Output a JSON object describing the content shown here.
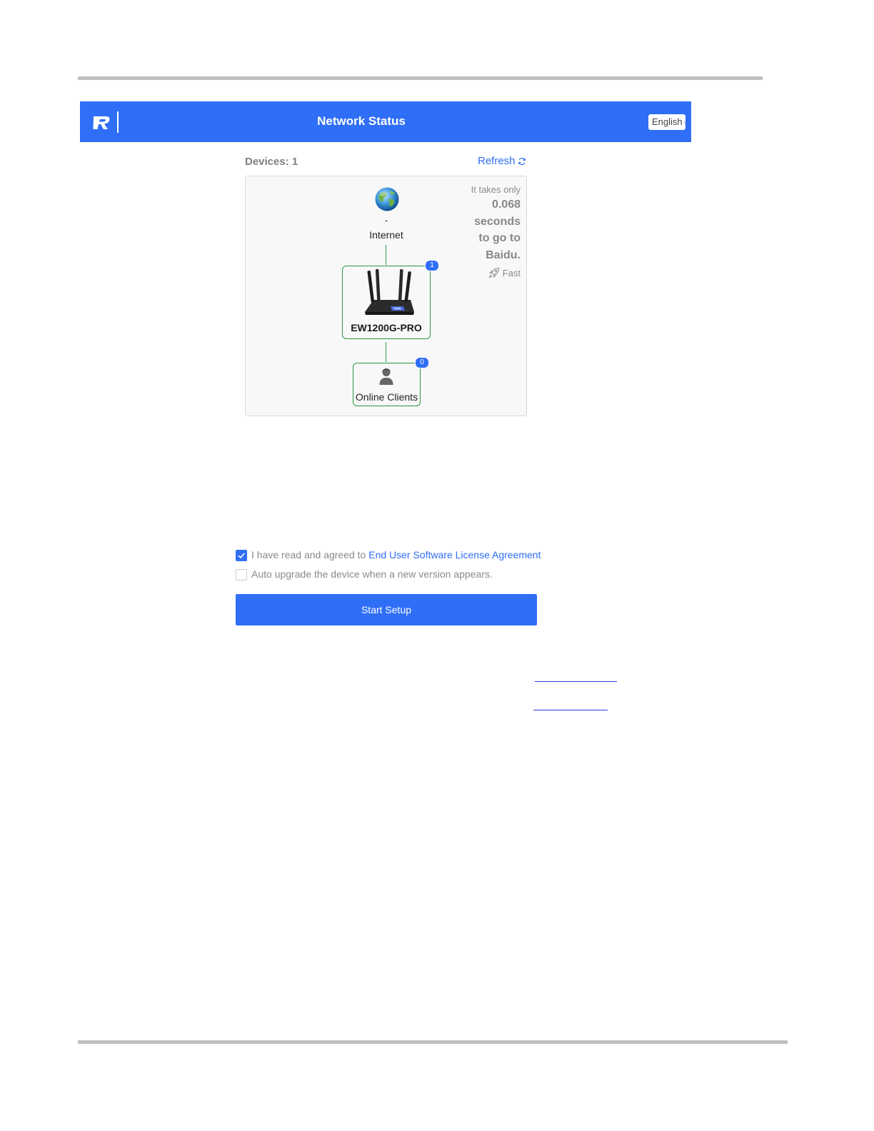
{
  "colors": {
    "brand": "#2f6ef6",
    "online_border": "#29963c",
    "badge": "#2f6ef6"
  },
  "header": {
    "logo_icon": "ruijie-logo-icon",
    "title": "Network Status",
    "language": "English"
  },
  "status": {
    "devices_label": "Devices: 1",
    "refresh_label": "Refresh",
    "refresh_icon": "refresh-icon"
  },
  "speed": {
    "line1": "It takes only",
    "value": "0.068",
    "line2": "seconds",
    "line3": "to go to",
    "line4": "Baidu.",
    "rating": "Fast",
    "rating_icon": "rocket-icon"
  },
  "topology": {
    "internet_icon": "globe-icon",
    "internet_value": "-",
    "internet_label": "Internet",
    "router_name": "EW1200G-PRO",
    "router_badge": "1",
    "clients_label": "Online Clients",
    "clients_badge": "0",
    "clients_icon": "user-icon"
  },
  "setup": {
    "agree_text": "I have read and agreed to ",
    "agree_link": "End User Software License Agreement",
    "agree_checked": true,
    "auto_upgrade_text": "Auto upgrade the device when a new version appears.",
    "auto_upgrade_checked": false,
    "start_button": "Start Setup"
  }
}
